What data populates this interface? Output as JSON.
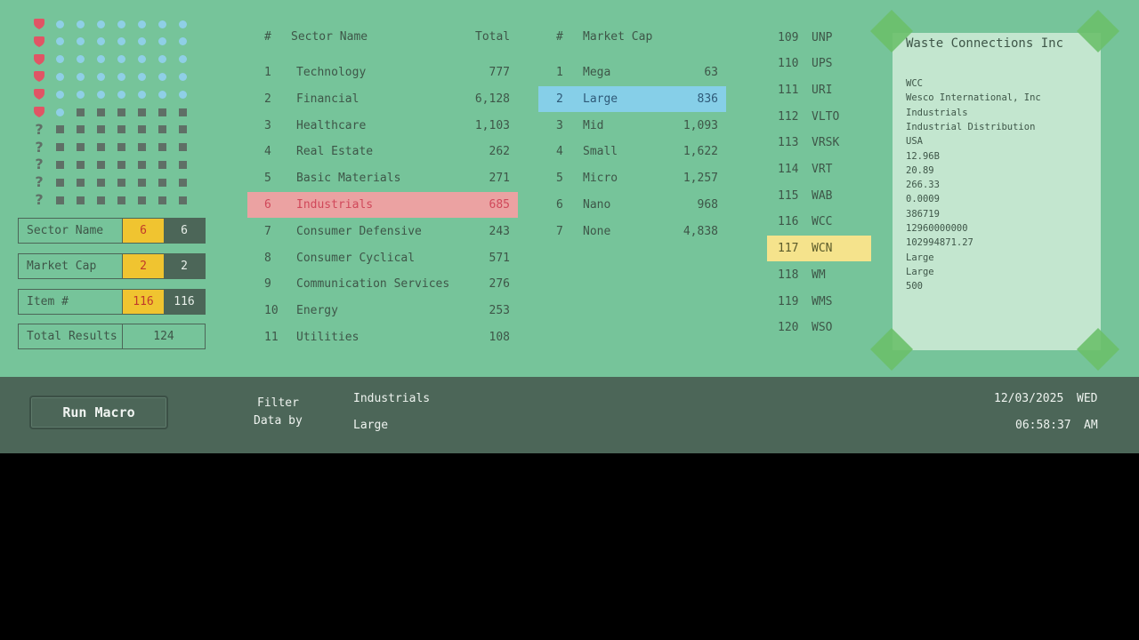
{
  "icon_grid": {
    "columns": [
      "heart",
      "dot",
      "dot",
      "dot",
      "dot",
      "dot",
      "dot",
      "dot"
    ],
    "rows": [
      [
        "heart",
        "dot",
        "dot",
        "dot",
        "dot",
        "dot",
        "dot",
        "dot"
      ],
      [
        "heart",
        "dot",
        "dot",
        "dot",
        "dot",
        "dot",
        "dot",
        "dot"
      ],
      [
        "heart",
        "dot",
        "dot",
        "dot",
        "dot",
        "dot",
        "dot",
        "dot"
      ],
      [
        "heart",
        "dot",
        "dot",
        "dot",
        "dot",
        "dot",
        "dot",
        "dot"
      ],
      [
        "heart",
        "dot",
        "dot",
        "dot",
        "dot",
        "dot",
        "dot",
        "dot"
      ],
      [
        "heart",
        "dot",
        "sq",
        "sq",
        "sq",
        "sq",
        "sq",
        "sq"
      ],
      [
        "question",
        "sq",
        "sq",
        "sq",
        "sq",
        "sq",
        "sq",
        "sq"
      ],
      [
        "question",
        "sq",
        "sq",
        "sq",
        "sq",
        "sq",
        "sq",
        "sq"
      ],
      [
        "question",
        "sq",
        "sq",
        "sq",
        "sq",
        "sq",
        "sq",
        "sq"
      ],
      [
        "question",
        "sq",
        "sq",
        "sq",
        "sq",
        "sq",
        "sq",
        "sq"
      ],
      [
        "question",
        "sq",
        "sq",
        "sq",
        "sq",
        "sq",
        "sq",
        "sq"
      ]
    ],
    "question_glyph": "?"
  },
  "filters": {
    "sector": {
      "label": "Sector Name",
      "v1": "6",
      "v2": "6"
    },
    "market": {
      "label": "Market Cap",
      "v1": "2",
      "v2": "2"
    },
    "item": {
      "label": "Item #",
      "v1": "116",
      "v2": "116"
    },
    "total": {
      "label": "Total Results",
      "value": "124"
    }
  },
  "sector_table": {
    "headers": {
      "num": "#",
      "name": "Sector Name",
      "total": "Total"
    },
    "rows": [
      {
        "num": "1",
        "name": "Technology",
        "total": "777"
      },
      {
        "num": "2",
        "name": "Financial",
        "total": "6,128"
      },
      {
        "num": "3",
        "name": "Healthcare",
        "total": "1,103"
      },
      {
        "num": "4",
        "name": "Real Estate",
        "total": "262"
      },
      {
        "num": "5",
        "name": "Basic Materials",
        "total": "271"
      },
      {
        "num": "6",
        "name": "Industrials",
        "total": "685"
      },
      {
        "num": "7",
        "name": "Consumer Defensive",
        "total": "243"
      },
      {
        "num": "8",
        "name": "Consumer Cyclical",
        "total": "571"
      },
      {
        "num": "9",
        "name": "Communication Services",
        "total": "276"
      },
      {
        "num": "10",
        "name": "Energy",
        "total": "253"
      },
      {
        "num": "11",
        "name": "Utilities",
        "total": "108"
      }
    ]
  },
  "market_table": {
    "headers": {
      "num": "#",
      "name": "Market Cap"
    },
    "rows": [
      {
        "num": "1",
        "name": "Mega",
        "total": "63"
      },
      {
        "num": "2",
        "name": "Large",
        "total": "836"
      },
      {
        "num": "3",
        "name": "Mid",
        "total": "1,093"
      },
      {
        "num": "4",
        "name": "Small",
        "total": "1,622"
      },
      {
        "num": "5",
        "name": "Micro",
        "total": "1,257"
      },
      {
        "num": "6",
        "name": "Nano",
        "total": "968"
      },
      {
        "num": "7",
        "name": "None",
        "total": "4,838"
      }
    ]
  },
  "ticker_list": {
    "rows": [
      {
        "num": "109",
        "ticker": "UNP"
      },
      {
        "num": "110",
        "ticker": "UPS"
      },
      {
        "num": "111",
        "ticker": "URI"
      },
      {
        "num": "112",
        "ticker": "VLTO"
      },
      {
        "num": "113",
        "ticker": "VRSK"
      },
      {
        "num": "114",
        "ticker": "VRT"
      },
      {
        "num": "115",
        "ticker": "WAB"
      },
      {
        "num": "116",
        "ticker": "WCC"
      },
      {
        "num": "117",
        "ticker": "WCN"
      },
      {
        "num": "118",
        "ticker": "WM"
      },
      {
        "num": "119",
        "ticker": "WMS"
      },
      {
        "num": "120",
        "ticker": "WSO"
      }
    ]
  },
  "note": {
    "title": "Waste Connections Inc",
    "lines": [
      "WCC",
      "Wesco International, Inc",
      "Industrials",
      "Industrial Distribution",
      "USA",
      "12.96B",
      "20.89",
      "266.33",
      "0.0009",
      "386719",
      "12960000000",
      "102994871.27",
      "Large",
      "Large",
      "500"
    ]
  },
  "bottom": {
    "run_button": "Run Macro",
    "filter_label_1": "Filter",
    "filter_label_2": "Data by",
    "filter_sector": "Industrials",
    "filter_market": "Large",
    "date": "12/03/2025",
    "weekday": "WED",
    "time": "06:58:37",
    "ampm": "AM"
  },
  "colors": {
    "background": "#76c49a",
    "bar": "#4c6658",
    "sector_highlight": "#eba2a2",
    "market_highlight": "#86cfe8",
    "ticker_highlight": "#f5e38c",
    "filter_value": "#f0c430"
  }
}
